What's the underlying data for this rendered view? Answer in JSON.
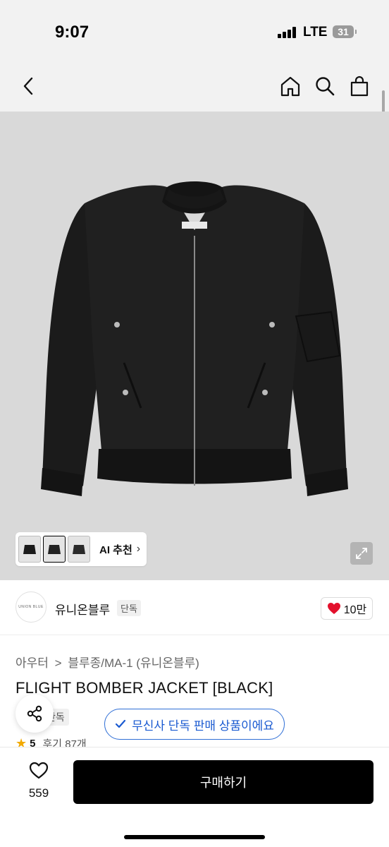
{
  "status": {
    "time": "9:07",
    "network": "LTE",
    "battery": "31"
  },
  "nav": {
    "back_icon": "chevron-left-icon",
    "home_icon": "home-icon",
    "search_icon": "search-icon",
    "cart_icon": "shopping-bag-icon"
  },
  "gallery": {
    "ai_label": "AI 추천",
    "ai_chevron": "›",
    "thumbnails": [
      "jacket-front",
      "jacket-front-alt",
      "jacket-back"
    ]
  },
  "brand": {
    "logo_text": "UNION BLUE",
    "name": "유니온블루",
    "badge": "단독",
    "like_count": "10만"
  },
  "product": {
    "breadcrumb_1": "아우터",
    "breadcrumb_sep": ">",
    "breadcrumb_2": "블루종/MA-1 (유니온블루)",
    "title": "FLIGHT BOMBER JACKET [BLACK]",
    "exclusive_badge": "단독",
    "exclusive_tip": "무신사 단독 판매 상품이에요",
    "rating": "5",
    "review_text": "후기 87개"
  },
  "bottom": {
    "wish_count": "559",
    "buy_label": "구매하기"
  },
  "colors": {
    "accent_blue": "#1a5ad1",
    "heart_red": "#e3102c",
    "star_yellow": "#f2a900",
    "buy_bg": "#000000"
  }
}
